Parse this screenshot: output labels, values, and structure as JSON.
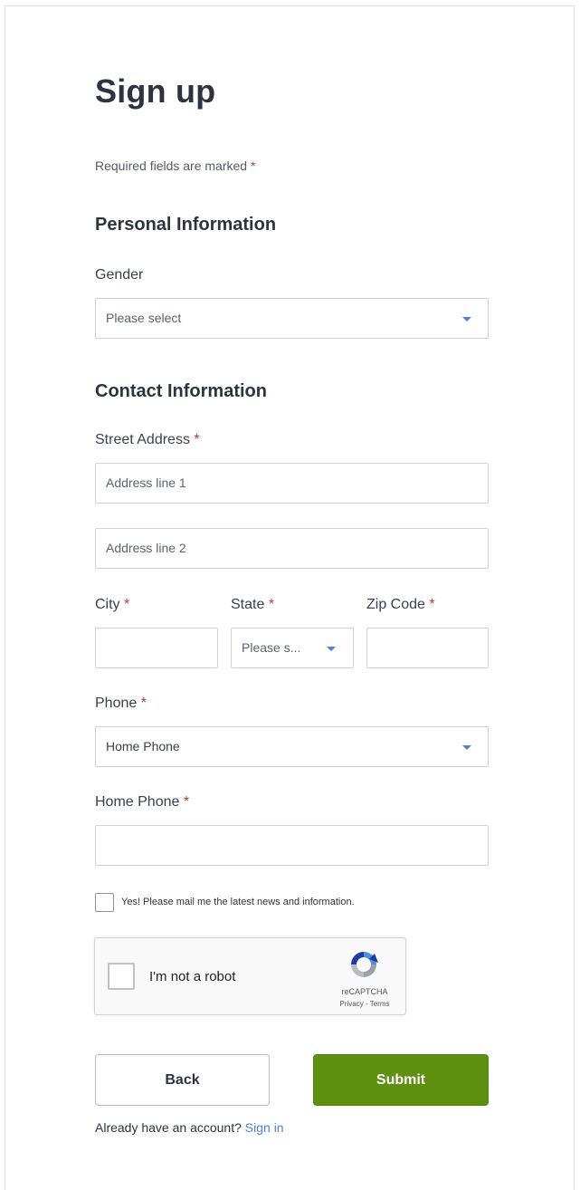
{
  "page": {
    "title": "Sign up",
    "required_hint": "Required fields are marked",
    "required_marker": "*"
  },
  "personal": {
    "heading": "Personal Information",
    "gender_label": "Gender",
    "gender_value": "Please select"
  },
  "contact": {
    "heading": "Contact Information",
    "street_label": "Street Address",
    "address1_placeholder": "Address line 1",
    "address2_placeholder": "Address line 2",
    "city_label": "City",
    "state_label": "State",
    "state_value": "Please s...",
    "zip_label": "Zip Code",
    "phone_label": "Phone",
    "phone_type_value": "Home Phone",
    "home_phone_label": "Home Phone"
  },
  "newsletter": {
    "label": "Yes! Please mail me the latest news and information.",
    "checked": false
  },
  "captcha": {
    "label": "I'm not a robot",
    "brand": "reCAPTCHA",
    "privacy": "Privacy",
    "separator": "-",
    "terms": "Terms",
    "checked": false
  },
  "actions": {
    "back_label": "Back",
    "submit_label": "Submit"
  },
  "footer": {
    "prompt": "Already have an account?",
    "signin_link": "Sign in"
  },
  "colors": {
    "accent_link": "#4f7fd6",
    "required": "#c0392b",
    "submit_bg": "#5e900f"
  }
}
